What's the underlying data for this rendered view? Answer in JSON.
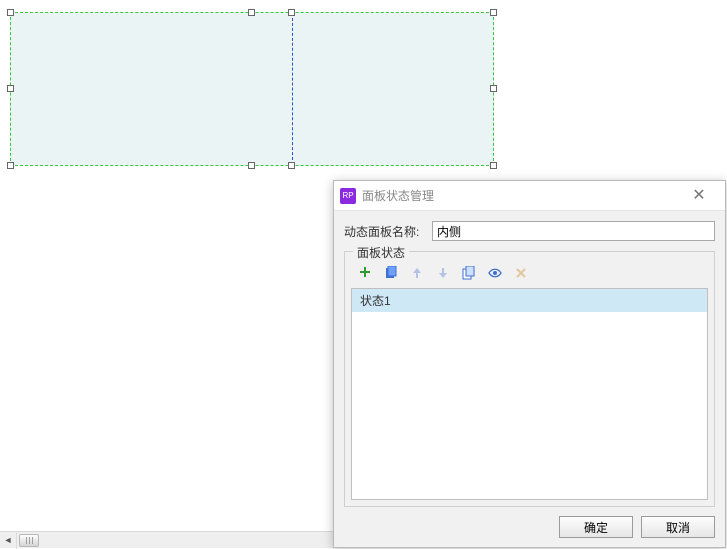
{
  "dialog": {
    "app_icon_text": "RP",
    "title": "面板状态管理",
    "name_label": "动态面板名称:",
    "name_value": "内侧",
    "fieldset_legend": "面板状态",
    "toolbar": {
      "add": "add-icon",
      "duplicate": "duplicate-icon",
      "move_up": "arrow-up-icon",
      "move_down": "arrow-down-icon",
      "copy": "copy-icon",
      "edit": "edit-icon",
      "delete": "delete-icon"
    },
    "states": [
      "状态1"
    ],
    "ok_label": "确定",
    "cancel_label": "取消"
  }
}
